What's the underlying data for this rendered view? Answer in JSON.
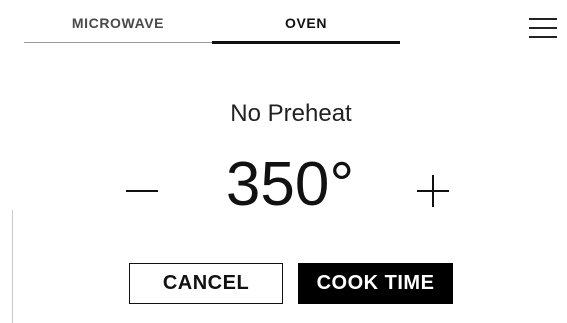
{
  "tabs": [
    {
      "label": "MICROWAVE",
      "active": false
    },
    {
      "label": "OVEN",
      "active": true
    }
  ],
  "menu_icon": "hamburger-menu-icon",
  "status": "No Preheat",
  "temperature": {
    "value": "350°",
    "decrease_icon": "minus-icon",
    "increase_icon": "plus-icon"
  },
  "actions": {
    "cancel_label": "CANCEL",
    "cook_time_label": "COOK TIME"
  },
  "colors": {
    "text": "#111111",
    "inactive_tab": "#4a4a4a",
    "primary_button_bg": "#000000",
    "primary_button_text": "#ffffff"
  }
}
